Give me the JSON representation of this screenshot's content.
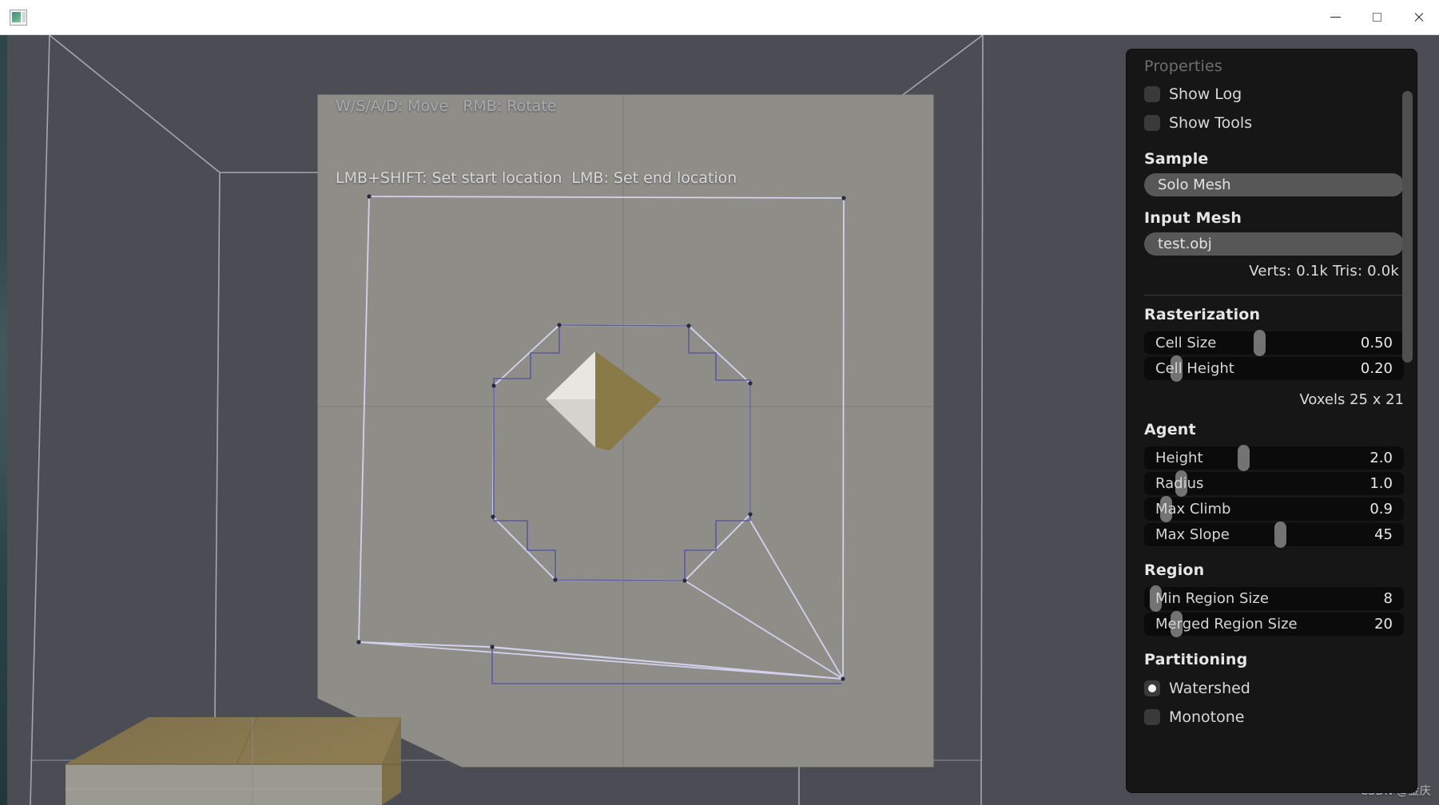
{
  "window": {
    "app_icon": "application-window-icon",
    "controls": {
      "minimize": "Minimize",
      "maximize": "Maximize",
      "close": "Close"
    }
  },
  "viewport": {
    "hud_line1": "W/S/A/D: Move   RMB: Rotate",
    "hud_line2": "LMB+SHIFT: Set start location  LMB: Set end location",
    "watermark": "CSDN @金庆",
    "background_color": "#4c4d54",
    "ground_color": "#8e8d88",
    "box_top_color": "#8a7950",
    "box_side_color": "#9a9992",
    "contour_color": "#cfcfe8",
    "contour_inner_color": "#5c5c9a",
    "bbox_line_color": "#b8b8bc"
  },
  "panel": {
    "title": "Properties",
    "toggles": [
      {
        "label": "Show Log",
        "checked": false
      },
      {
        "label": "Show Tools",
        "checked": false
      }
    ],
    "sample": {
      "heading": "Sample",
      "value": "Solo Mesh"
    },
    "input_mesh": {
      "heading": "Input Mesh",
      "value": "test.obj",
      "stats": "Verts: 0.1k  Tris: 0.0k"
    },
    "rasterization": {
      "heading": "Rasterization",
      "sliders": [
        {
          "label": "Cell Size",
          "value": "0.50",
          "knob_pct": 42
        },
        {
          "label": "Cell Height",
          "value": "0.20",
          "knob_pct": 10
        }
      ],
      "voxels": "Voxels  25 x 21"
    },
    "agent": {
      "heading": "Agent",
      "sliders": [
        {
          "label": "Height",
          "value": "2.0",
          "knob_pct": 36
        },
        {
          "label": "Radius",
          "value": "1.0",
          "knob_pct": 12
        },
        {
          "label": "Max Climb",
          "value": "0.9",
          "knob_pct": 6
        },
        {
          "label": "Max Slope",
          "value": "45",
          "knob_pct": 50
        }
      ]
    },
    "region": {
      "heading": "Region",
      "sliders": [
        {
          "label": "Min Region Size",
          "value": "8",
          "knob_pct": 2
        },
        {
          "label": "Merged Region Size",
          "value": "20",
          "knob_pct": 10
        }
      ]
    },
    "partitioning": {
      "heading": "Partitioning",
      "options": [
        {
          "label": "Watershed",
          "selected": true
        },
        {
          "label": "Monotone",
          "selected": false
        }
      ]
    },
    "scrollbar": {
      "thumb_top_pct": 5,
      "thumb_height_pct": 37
    }
  }
}
